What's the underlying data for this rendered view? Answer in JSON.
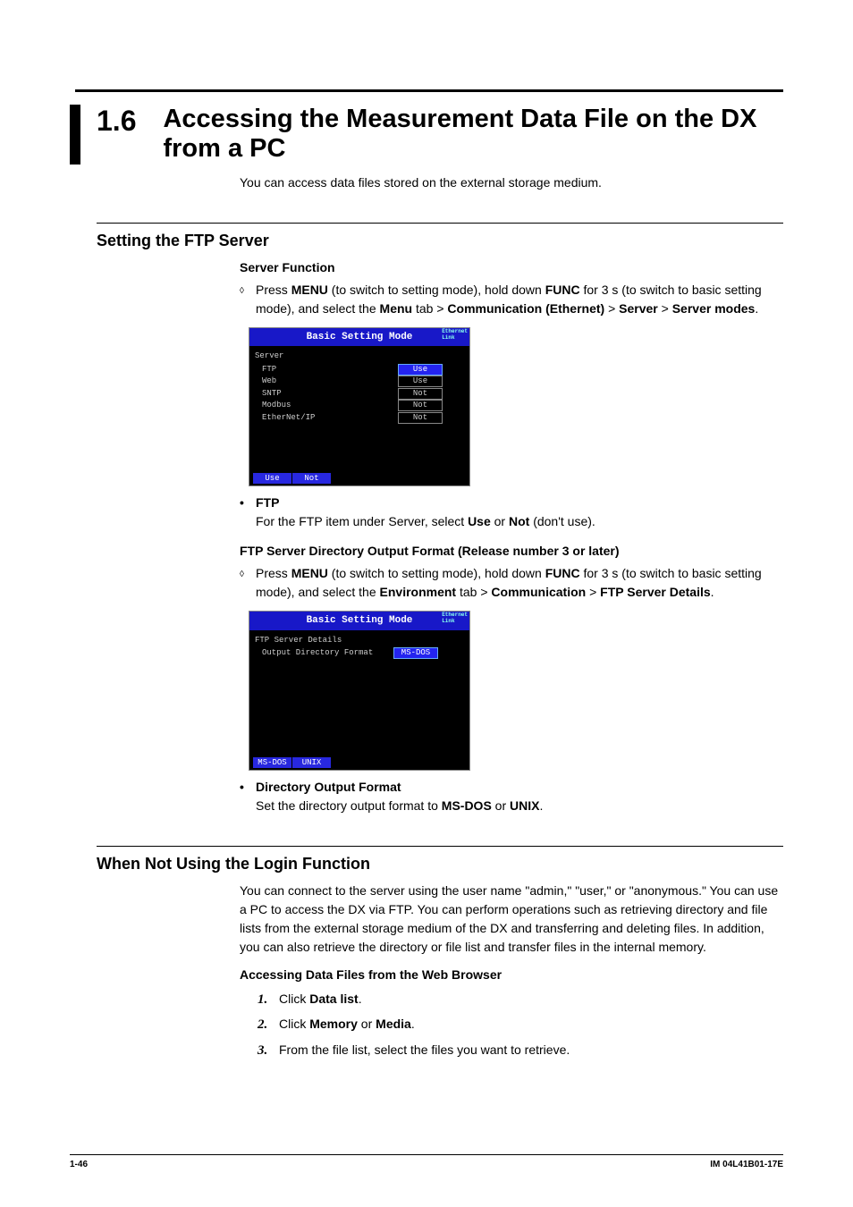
{
  "section": {
    "num": "1.6",
    "title": "Accessing the Measurement Data File on the DX from a PC"
  },
  "intro": "You can access data files stored on the external storage medium.",
  "h2_1": "Setting the FTP Server",
  "h3_sf": "Server Function",
  "sf_intro": {
    "p1": "Press ",
    "b1": "MENU",
    "p2": " (to switch to setting mode), hold down ",
    "b2": "FUNC",
    "p3": " for 3 s (to switch to basic setting mode), and select the ",
    "b3": "Menu",
    "p4": " tab > ",
    "b4": "Communication (Ethernet)",
    "p5": " > ",
    "b5": "Server",
    "p6": " > ",
    "b6": "Server modes",
    "p7": "."
  },
  "screen1": {
    "title": "Basic Setting Mode",
    "eth1": "Ethernet",
    "eth2": "Link",
    "group": "Server",
    "rows": [
      {
        "label": "FTP",
        "val": "Use",
        "sel": true
      },
      {
        "label": "Web",
        "val": "Use",
        "sel": false
      },
      {
        "label": "SNTP",
        "val": "Not",
        "sel": false
      },
      {
        "label": "Modbus",
        "val": "Not",
        "sel": false
      },
      {
        "label": "EtherNet/IP",
        "val": "Not",
        "sel": false
      }
    ],
    "btns": [
      "Use",
      "Not"
    ]
  },
  "ftp_item": {
    "title": "FTP",
    "p1": "For the FTP item under Server, select ",
    "b1": "Use",
    "p2": " or ",
    "b2": "Not",
    "p3": " (don't use)."
  },
  "h3_dir": "FTP Server Directory Output Format (Release number 3 or later)",
  "dir_intro": {
    "p1": "Press ",
    "b1": "MENU",
    "p2": " (to switch to setting mode), hold down ",
    "b2": "FUNC",
    "p3": " for 3 s (to switch to basic setting mode), and select the ",
    "b3": "Environment",
    "p4": " tab > ",
    "b4": "Communication",
    "p5": " > ",
    "b5": "FTP Server Details",
    "p6": "."
  },
  "screen2": {
    "title": "Basic Setting Mode",
    "eth1": "Ethernet",
    "eth2": "Link",
    "group": "FTP Server Details",
    "row": {
      "label": "Output Directory Format",
      "val": "MS-DOS"
    },
    "btns": [
      "MS-DOS",
      "UNIX"
    ]
  },
  "dof_item": {
    "title": "Directory Output Format",
    "p1": "Set the directory output format to ",
    "b1": "MS-DOS",
    "p2": " or ",
    "b2": "UNIX",
    "p3": "."
  },
  "h2_2": "When Not Using the Login Function",
  "not_login": "You can connect to the server using the user name \"admin,\" \"user,\" or \"anonymous.\" You can use a PC to access the DX via FTP. You can perform operations such as retrieving directory and file lists from the external storage medium of the DX and transferring and deleting files. In addition, you can also retrieve the directory or file list and transfer files in the internal memory.",
  "h3_access": "Accessing Data Files from the Web Browser",
  "steps": [
    {
      "n": "1.",
      "p1": "Click ",
      "b1": "Data list",
      "p2": "."
    },
    {
      "n": "2.",
      "p1": "Click ",
      "b1": "Memory",
      "p2": " or ",
      "b2": "Media",
      "p3": "."
    },
    {
      "n": "3.",
      "p1": "From the file list, select the files you want to retrieve.",
      "b1": "",
      "p2": ""
    }
  ],
  "footer": {
    "left": "1-46",
    "right": "IM 04L41B01-17E"
  }
}
